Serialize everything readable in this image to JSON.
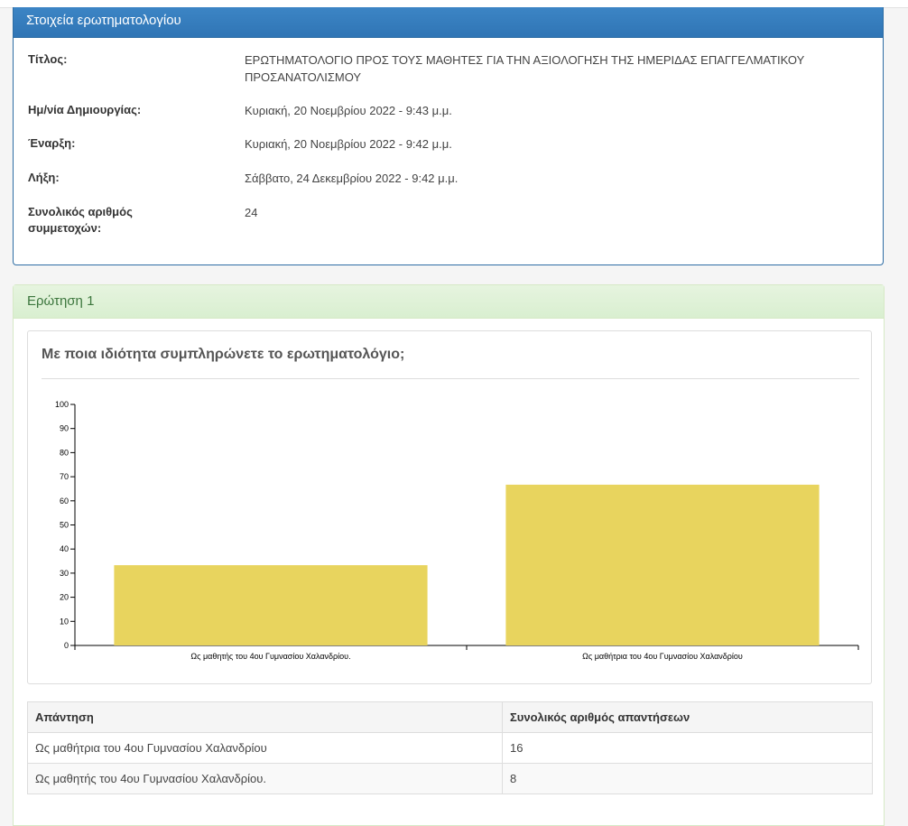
{
  "info_panel": {
    "heading": "Στοιχεία ερωτηματολογίου",
    "rows": [
      {
        "label": "Τίτλος:",
        "value": "ΕΡΩΤΗΜΑΤΟΛΟΓΙΟ ΠΡΟΣ ΤΟΥΣ ΜΑΘΗΤΕΣ ΓΙΑ ΤΗΝ ΑΞΙΟΛΟΓΗΣΗ ΤΗΣ ΗΜΕΡΙΔΑΣ ΕΠΑΓΓΕΛΜΑΤΙΚΟΥ ΠΡΟΣΑΝΑΤΟΛΙΣΜΟΥ"
      },
      {
        "label": "Ημ/νία Δημιουργίας:",
        "value": "Κυριακή, 20 Νοεμβρίου 2022 - 9:43 μ.μ."
      },
      {
        "label": "Έναρξη:",
        "value": "Κυριακή, 20 Νοεμβρίου 2022 - 9:42 μ.μ."
      },
      {
        "label": "Λήξη:",
        "value": "Σάββατο, 24 Δεκεμβρίου 2022 - 9:42 μ.μ."
      },
      {
        "label": "Συνολικός αριθμός συμμετοχών:",
        "value": "24"
      }
    ]
  },
  "question_panel": {
    "heading": "Ερώτηση 1",
    "question": "Με ποια ιδιότητα συμπληρώνετε το ερωτηματολόγιο;"
  },
  "chart_data": {
    "type": "bar",
    "title": "",
    "categories": [
      "Ως μαθητής του 4ου Γυμνασίου Χαλανδρίου.",
      "Ως μαθήτρια του 4ου Γυμνασίου Χαλανδρίου"
    ],
    "values": [
      33.3,
      66.7
    ],
    "ylim": [
      0,
      100
    ],
    "yticks": [
      0,
      10,
      20,
      30,
      40,
      50,
      60,
      70,
      80,
      90,
      100
    ],
    "bar_color": "#e8d45e",
    "xlabel": "",
    "ylabel": "",
    "grid": false
  },
  "answers_table": {
    "headers": [
      "Απάντηση",
      "Συνολικός αριθμός απαντήσεων"
    ],
    "rows": [
      {
        "answer": "Ως μαθήτρια του 4ου Γυμνασίου Χαλανδρίου",
        "count": "16"
      },
      {
        "answer": "Ως μαθητής του 4ου Γυμνασίου Χαλανδρίου.",
        "count": "8"
      }
    ]
  }
}
